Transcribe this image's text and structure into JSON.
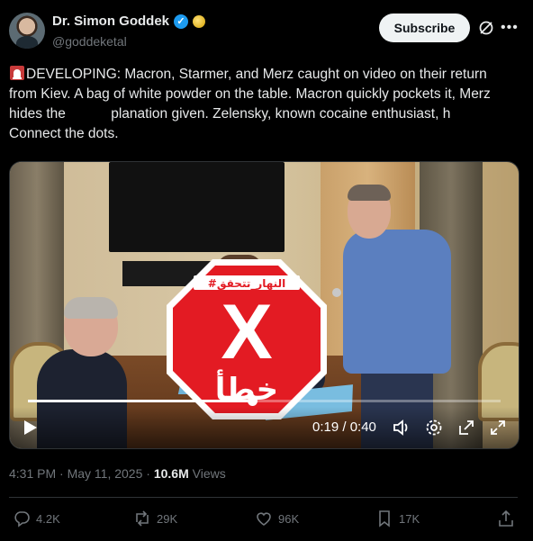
{
  "author": {
    "name": "Dr. Simon Goddek",
    "handle": "@goddeketal",
    "subscribe_label": "Subscribe"
  },
  "tweet": {
    "text_pre": "DEVELOPING: Macron, Starmer, and Merz caught on video on their return from Kiev. A bag of white powder on the table. Macron quickly pockets it, Merz hides the",
    "text_hidden_gap": "",
    "text_post_1": "planation given. Zelensky, known cocaine enthusiast, h",
    "text_post_2": "Connect the dots.",
    "emoji_icon": "rotating-light-icon"
  },
  "fact_check_stamp": {
    "header": "#النهار_تتحقق",
    "mark": "X",
    "verdict": "خطأ",
    "color": "#e31b23"
  },
  "video": {
    "time": "0:19 / 0:40",
    "progress": 0.475,
    "controls": [
      "play-icon",
      "volume-icon",
      "settings-icon",
      "pop-out-icon",
      "fullscreen-icon"
    ]
  },
  "meta": {
    "time": "4:31 PM · May 11, 2025 · ",
    "views": "10.6M",
    "views_label": " Views"
  },
  "actions": {
    "replies": "4.2K",
    "reposts": "29K",
    "likes": "96K",
    "bookmarks": "17K"
  },
  "colors": {
    "background": "#000000",
    "text": "#e7e9ea",
    "muted": "#71767b",
    "verified": "#1d9bf0"
  }
}
